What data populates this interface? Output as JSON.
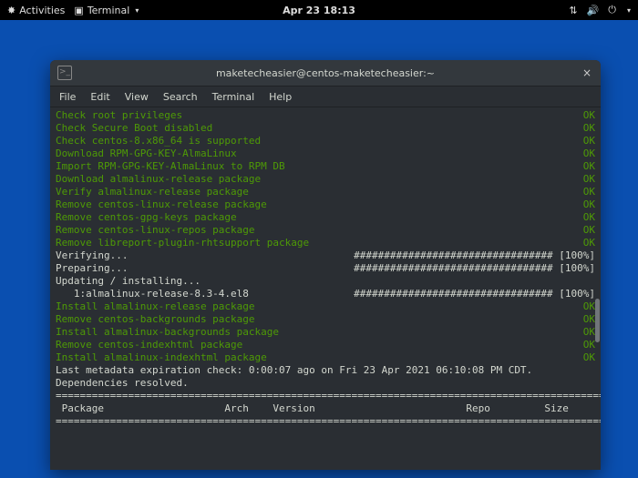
{
  "panel": {
    "activities": "Activities",
    "app_label": "Terminal",
    "clock": "Apr 23 18:13"
  },
  "window": {
    "title": "maketecheasier@centos-maketecheasier:~",
    "term_icon_glyph": ">_",
    "close_glyph": "×"
  },
  "menubar": [
    "File",
    "Edit",
    "View",
    "Search",
    "Terminal",
    "Help"
  ],
  "ok_lines_top": [
    "Check root privileges",
    "Check Secure Boot disabled",
    "Check centos-8.x86_64 is supported",
    "Download RPM-GPG-KEY-AlmaLinux",
    "Import RPM-GPG-KEY-AlmaLinux to RPM DB",
    "Download almalinux-release package",
    "Verify almalinux-release package",
    "Remove centos-linux-release package",
    "Remove centos-gpg-keys package",
    "Remove centos-linux-repos package",
    "Remove libreport-plugin-rhtsupport package"
  ],
  "ok_status": "OK",
  "progress1": {
    "label": "Verifying...",
    "bar": "################################# [100%]"
  },
  "progress2": {
    "label": "Preparing...",
    "bar": "################################# [100%]"
  },
  "updating_label": "Updating / installing...",
  "progress3": {
    "label": "   1:almalinux-release-8.3-4.el8",
    "bar": "################################# [100%]"
  },
  "ok_lines_mid": [
    "Install almalinux-release package",
    "Remove centos-backgrounds package",
    "Install almalinux-backgrounds package",
    "Remove centos-indexhtml package",
    "Install almalinux-indexhtml package"
  ],
  "meta_line": "Last metadata expiration check: 0:00:07 ago on Fri 23 Apr 2021 06:10:08 PM CDT.",
  "deps_line": "Dependencies resolved.",
  "rule": "===========================================================================================",
  "header": " Package                    Arch    Version                         Repo         Size"
}
